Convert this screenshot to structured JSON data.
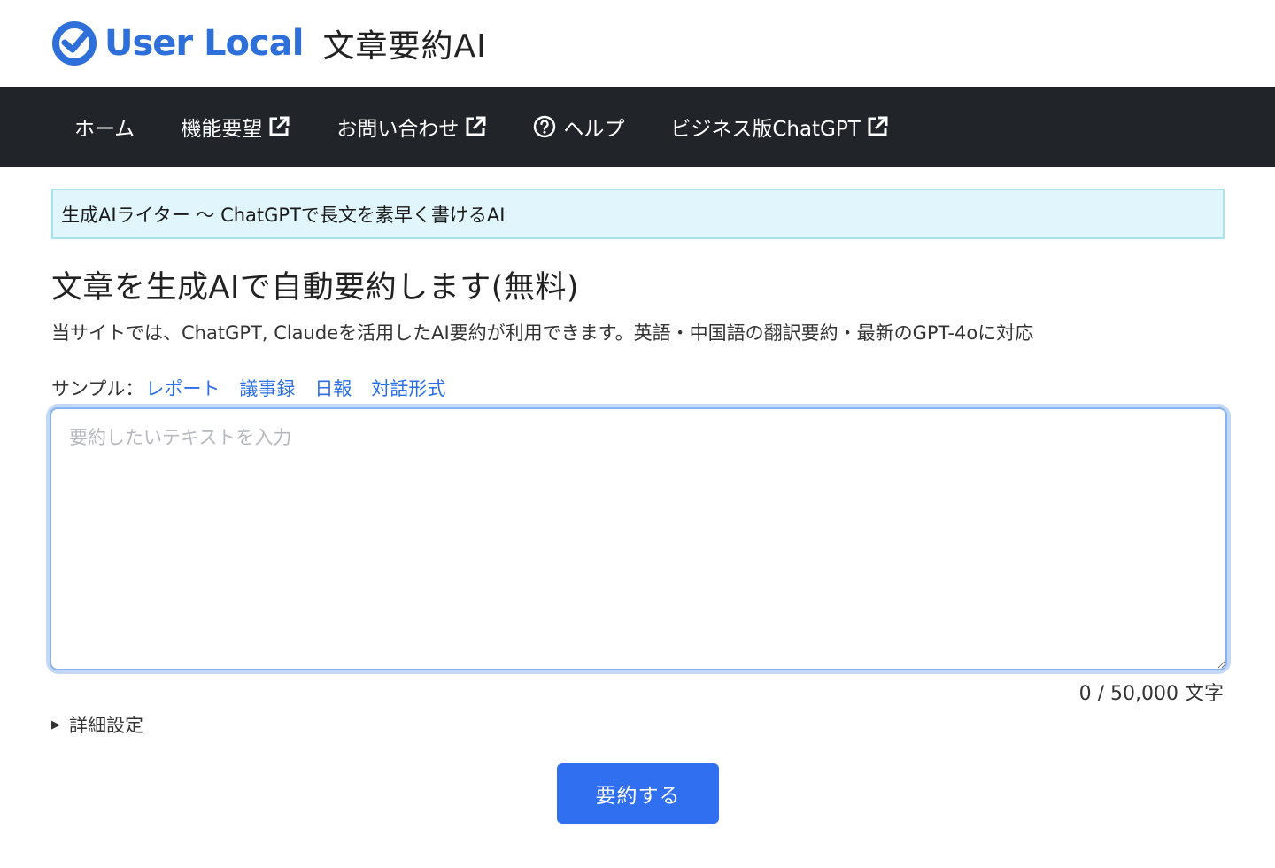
{
  "brand": {
    "logo_text": "User Local",
    "app_title": "文章要約AI"
  },
  "nav": {
    "items": [
      {
        "label": "ホーム",
        "icon": null
      },
      {
        "label": "機能要望",
        "icon": "external-link-icon"
      },
      {
        "label": "お問い合わせ",
        "icon": "external-link-icon"
      },
      {
        "label": "ヘルプ",
        "icon": "help-circle-icon"
      },
      {
        "label": "ビジネス版ChatGPT",
        "icon": "external-link-icon"
      }
    ]
  },
  "banner": {
    "text": "生成AIライター 〜 ChatGPTで長文を素早く書けるAI"
  },
  "main": {
    "heading": "文章を生成AIで自動要約します(無料)",
    "lead": "当サイトでは、ChatGPT, Claudeを活用したAI要約が利用できます。英語・中国語の翻訳要約・最新のGPT-4oに対応",
    "samples_label": "サンプル：",
    "samples": [
      "レポート",
      "議事録",
      "日報",
      "対話形式"
    ],
    "textarea_placeholder": "要約したいテキストを入力",
    "textarea_value": "",
    "counter": "0 / 50,000 文字",
    "details_label": "詳細設定",
    "submit_label": "要約する"
  },
  "colors": {
    "brand_blue": "#2f6fd9",
    "navbar_bg": "#212529",
    "banner_bg": "#e0f6fc",
    "banner_border": "#a6e3ef",
    "link": "#2a6ee8",
    "button_bg": "#2f6ff0"
  }
}
